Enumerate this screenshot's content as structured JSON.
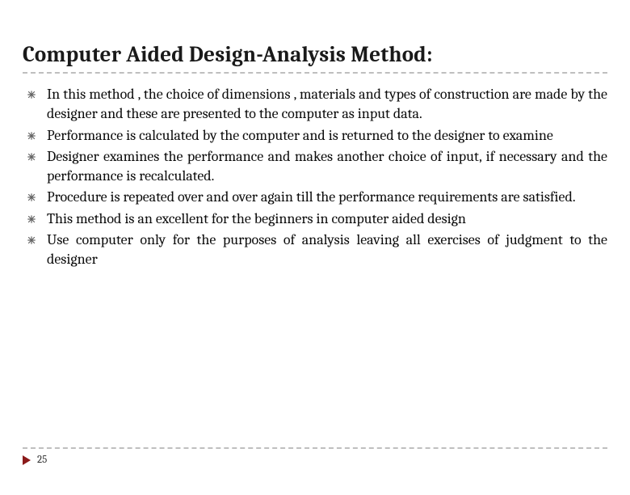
{
  "title": "Computer Aided Design-Analysis Method:",
  "bullets": [
    "In this method , the choice of dimensions , materials and types of construction are made by the designer and these are presented  to the computer as input data.",
    "Performance is calculated by the computer and is returned to the designer to examine",
    "Designer examines the performance and makes another choice of input, if necessary and the performance is recalculated.",
    "Procedure is repeated over and over again till the performance requirements are satisfied.",
    "This method is an excellent for the beginners in computer aided design",
    "Use computer only for the purposes of analysis leaving all exercises of judgment to the designer"
  ],
  "page_number": "25"
}
